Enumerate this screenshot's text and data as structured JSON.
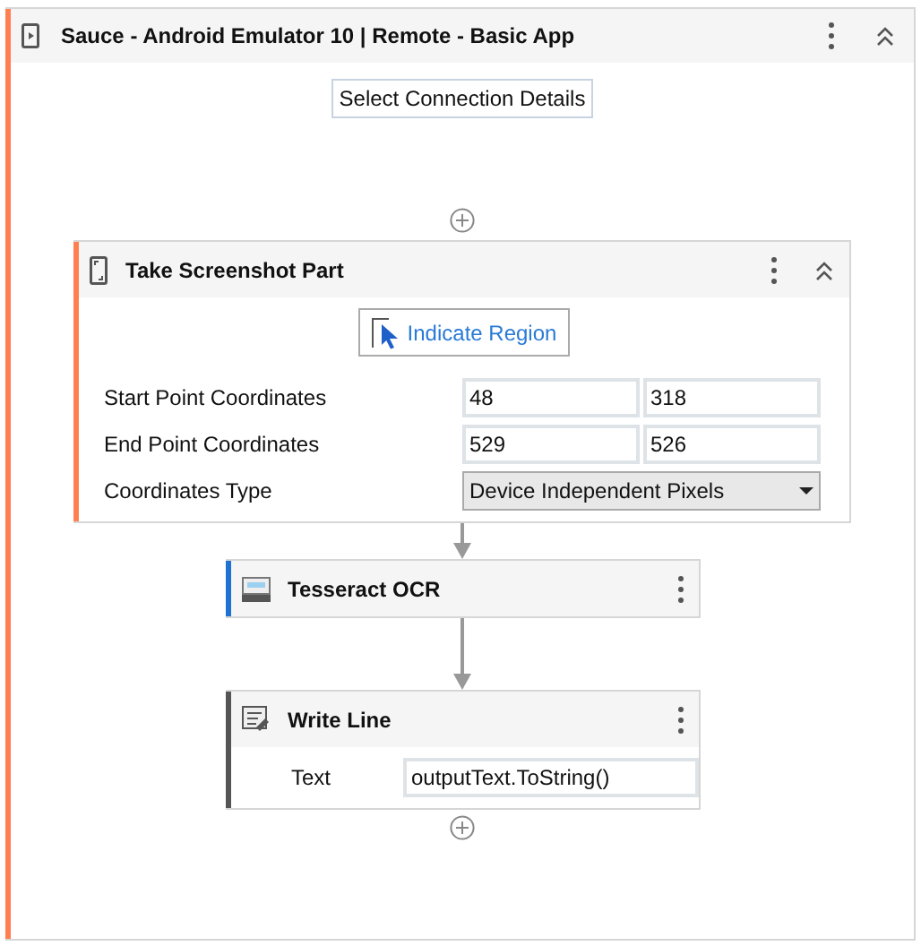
{
  "sequence": {
    "title": "Sauce - Android Emulator 10 | Remote - Basic App",
    "color": "#ff7f50",
    "connection_button": "Select Connection Details"
  },
  "activities": [
    {
      "kind": "screenshot",
      "title": "Take Screenshot Part",
      "color": "#ff7f50",
      "indicate_button": "Indicate Region",
      "fields": [
        {
          "kind": "pair",
          "label": "Start Point Coordinates",
          "values": [
            "48",
            "318"
          ]
        },
        {
          "kind": "pair",
          "label": "End Point Coordinates",
          "values": [
            "529",
            "526"
          ]
        },
        {
          "kind": "dropdown",
          "label": "Coordinates Type",
          "value": "Device Independent Pixels"
        }
      ]
    },
    {
      "kind": "ocr",
      "title": "Tesseract OCR",
      "color": "#1e73d2"
    },
    {
      "kind": "write_line",
      "title": "Write Line",
      "color": "#555555",
      "fields": [
        {
          "kind": "text",
          "label": "Text",
          "value": "outputText.ToString()"
        }
      ]
    }
  ]
}
